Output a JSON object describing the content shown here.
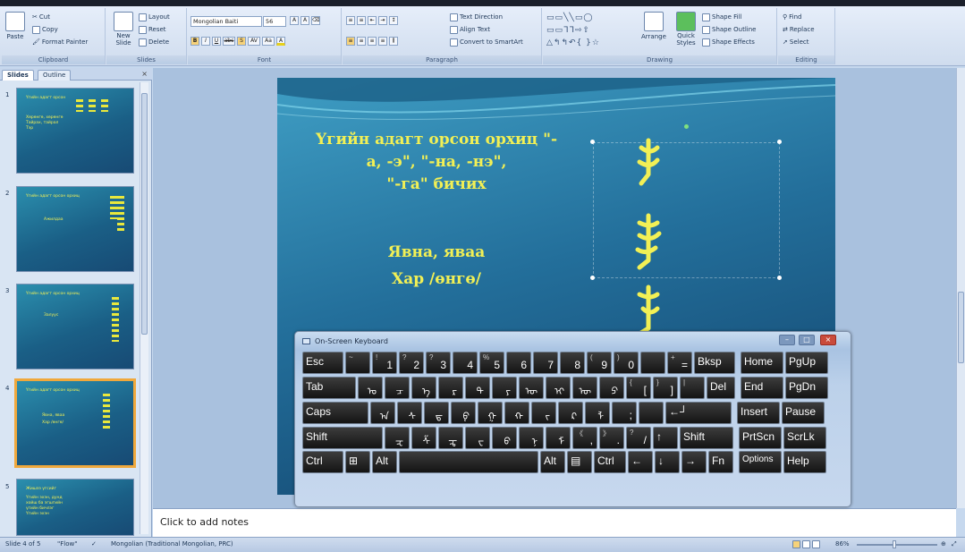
{
  "ribbon": {
    "clipboard": {
      "paste": "Paste",
      "cut": "Cut",
      "copy": "Copy",
      "format_painter": "Format Painter",
      "label": "Clipboard"
    },
    "slides": {
      "new_slide": "New Slide",
      "layout": "Layout",
      "reset": "Reset",
      "delete": "Delete",
      "label": "Slides"
    },
    "font": {
      "name": "Mongolian Baiti",
      "size": "56",
      "label": "Font",
      "bold": "B",
      "italic": "I",
      "underline": "U",
      "strike": "abc",
      "shadow": "S",
      "spacing": "AV",
      "case": "Aa",
      "color": "A",
      "grow": "A",
      "shrink": "A"
    },
    "paragraph": {
      "text_direction": "Text Direction",
      "align_text": "Align Text",
      "convert_smartart": "Convert to SmartArt",
      "label": "Paragraph"
    },
    "drawing": {
      "arrange": "Arrange",
      "quick_styles": "Quick Styles",
      "shape_fill": "Shape Fill",
      "shape_outline": "Shape Outline",
      "shape_effects": "Shape Effects",
      "label": "Drawing"
    },
    "editing": {
      "find": "Find",
      "replace": "Replace",
      "select": "Select",
      "label": "Editing"
    }
  },
  "left_pane": {
    "tabs": [
      "Slides",
      "Outline"
    ],
    "close": "×",
    "thumbnails": [
      {
        "num": "1",
        "title": "Үгийн адагт орсон",
        "body": [
          "Хөрөнгө, хөрөнгө",
          "Тайрах, тайрал",
          "Тэр"
        ]
      },
      {
        "num": "2",
        "title": "Үгийн адагт орсон орхиц",
        "body": [
          "Ажилдаа"
        ]
      },
      {
        "num": "3",
        "title": "Үгийн адагт орсон орхиц",
        "body": [
          "Залуус"
        ]
      },
      {
        "num": "4",
        "title": "Үгийн адагт орсон орхиц",
        "body": [
          "Явна, яваа",
          "Хар /өнгө/"
        ]
      },
      {
        "num": "5",
        "title": "Жишээ үгсийг",
        "body": [
          "Үгийн эхэн, дунд",
          "хойш ба эгшгийн",
          "үгийн бичлэг",
          "Үгийн эхэн"
        ]
      }
    ]
  },
  "slide": {
    "title_lines": [
      "Үгийн адагт орсон орхиц \"-",
      "а, -э\", \"-на, -нэ\",",
      "\"-га\" бичих"
    ],
    "examples": [
      "Явна, яваа",
      "Хар /өнгө/"
    ]
  },
  "notes": {
    "placeholder": "Click to add notes"
  },
  "status": {
    "slide": "Slide 4 of 5",
    "theme": "\"Flow\"",
    "language": "Mongolian (Traditional Mongolian, PRC)",
    "zoom": "86%"
  },
  "osk": {
    "title": "On-Screen Keyboard",
    "win_buttons": [
      "–",
      "□",
      "×"
    ],
    "rows": [
      [
        {
          "t": "Esc"
        },
        {
          "s": "~",
          "m": ""
        },
        {
          "s": "!",
          "m": "1"
        },
        {
          "s": "?",
          "m": "2"
        },
        {
          "s": "?",
          "m": "3"
        },
        {
          "s": "",
          "m": "4"
        },
        {
          "s": "%",
          "m": "5"
        },
        {
          "s": "",
          "m": "6"
        },
        {
          "s": "",
          "m": "7"
        },
        {
          "s": "",
          "m": "8"
        },
        {
          "s": "(",
          "m": "9"
        },
        {
          "s": ")",
          "m": "0"
        },
        {
          "s": "",
          "m": ""
        },
        {
          "s": "+",
          "m": "="
        },
        {
          "t": "Bksp"
        },
        {
          "t": "Home"
        },
        {
          "t": "PgUp"
        }
      ],
      [
        {
          "t": "Tab"
        },
        {
          "g": "ᠣ"
        },
        {
          "g": "ᠴ"
        },
        {
          "g": "ᠡ"
        },
        {
          "g": "ᠷ"
        },
        {
          "g": "ᠲ"
        },
        {
          "g": "ᠶ"
        },
        {
          "g": "ᠦ"
        },
        {
          "g": "ᠢ"
        },
        {
          "g": "ᠥ"
        },
        {
          "g": "ᠫ"
        },
        {
          "s": "{",
          "m": "["
        },
        {
          "s": "}",
          "m": "]"
        },
        {
          "s": "|",
          "m": ""
        },
        {
          "t": "Del"
        },
        {
          "t": "End"
        },
        {
          "t": "PgDn"
        }
      ],
      [
        {
          "t": "Caps"
        },
        {
          "g": "ᠠ"
        },
        {
          "g": "ᠰ"
        },
        {
          "g": "ᠳ"
        },
        {
          "g": "ᠹ"
        },
        {
          "g": "ᠭ"
        },
        {
          "g": "ᠬ"
        },
        {
          "g": "ᠵ"
        },
        {
          "g": "ᠺ"
        },
        {
          "g": "ᠯ"
        },
        {
          "s": "",
          "m": ";"
        },
        {
          "s": "",
          "m": ""
        },
        {
          "t": "←┘"
        },
        {
          "t": "Insert"
        },
        {
          "t": "Pause"
        }
      ],
      [
        {
          "t": "Shift"
        },
        {
          "g": "ᠽ"
        },
        {
          "g": "ᠱ"
        },
        {
          "g": "ᠼ"
        },
        {
          "g": "ᠸ"
        },
        {
          "g": "ᠪ"
        },
        {
          "g": "ᠨ"
        },
        {
          "g": "ᠮ"
        },
        {
          "s": "《",
          "m": ","
        },
        {
          "s": "》",
          "m": "."
        },
        {
          "s": "?",
          "m": "/"
        },
        {
          "t": "↑"
        },
        {
          "t": "Shift"
        },
        {
          "t": "PrtScn"
        },
        {
          "t": "ScrLk"
        }
      ],
      [
        {
          "t": "Ctrl"
        },
        {
          "t": "⊞"
        },
        {
          "t": "Alt"
        },
        {
          "t": ""
        },
        {
          "t": "Alt"
        },
        {
          "t": "▤"
        },
        {
          "t": "Ctrl"
        },
        {
          "t": "←"
        },
        {
          "t": "↓"
        },
        {
          "t": "→"
        },
        {
          "t": "Fn"
        },
        {
          "t": "Options"
        },
        {
          "t": "Help"
        }
      ]
    ]
  }
}
